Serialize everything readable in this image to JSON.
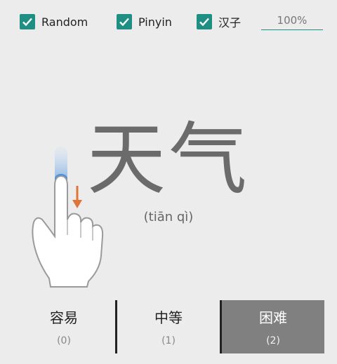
{
  "colors": {
    "accent": "#1f8f84",
    "selected_bg": "#808080",
    "swipe_arrow": "#e0733a",
    "touch_blue": "#4a90d9"
  },
  "options": [
    {
      "label": "Random",
      "checked": true
    },
    {
      "label": "Pinyin",
      "checked": true
    },
    {
      "label": "汉子",
      "checked": true
    }
  ],
  "zoom_value": "100%",
  "card": {
    "hanzi": "天气",
    "pinyin": "(tiān qì)"
  },
  "gesture": {
    "icon": "swipe-down-hand-icon"
  },
  "choices": [
    {
      "title": "容易",
      "count": "(0)",
      "selected": false
    },
    {
      "title": "中等",
      "count": "(1)",
      "selected": false
    },
    {
      "title": "困难",
      "count": "(2)",
      "selected": true
    }
  ]
}
